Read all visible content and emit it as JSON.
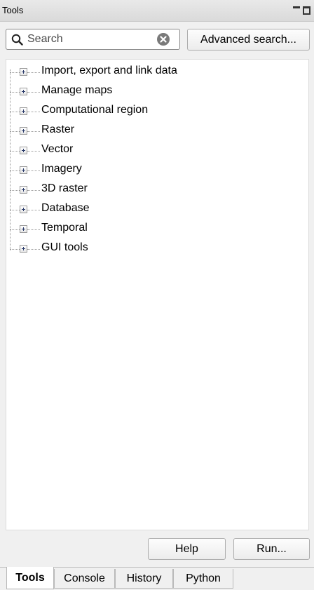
{
  "panel": {
    "title": "Tools"
  },
  "search": {
    "placeholder": "Search",
    "advanced_label": "Advanced search..."
  },
  "tree": {
    "items": [
      {
        "label": "Import, export and link data"
      },
      {
        "label": "Manage maps"
      },
      {
        "label": "Computational region"
      },
      {
        "label": "Raster"
      },
      {
        "label": "Vector"
      },
      {
        "label": "Imagery"
      },
      {
        "label": "3D raster"
      },
      {
        "label": "Database"
      },
      {
        "label": "Temporal"
      },
      {
        "label": "GUI tools"
      }
    ]
  },
  "actions": {
    "help_label": "Help",
    "run_label": "Run..."
  },
  "tabs": [
    {
      "label": "Tools",
      "active": true
    },
    {
      "label": "Console",
      "active": false
    },
    {
      "label": "History",
      "active": false
    },
    {
      "label": "Python",
      "active": false
    }
  ],
  "icons": {
    "search": "search-icon",
    "clear": "clear-icon",
    "expander": "plus-expander-icon",
    "minimize": "minimize-icon",
    "maximize": "maximize-icon"
  }
}
